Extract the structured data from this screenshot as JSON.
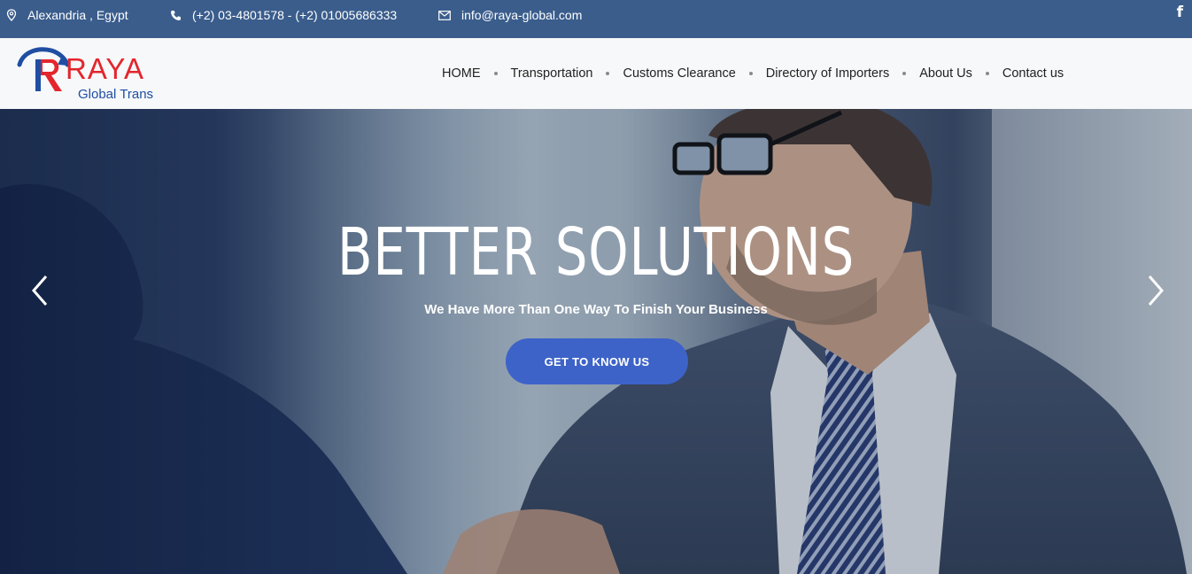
{
  "topbar": {
    "location": "Alexandria , Egypt",
    "phone": "(+2) 03-4801578 - (+2) 01005686333",
    "email": "info@raya-global.com",
    "social_icon": "facebook-icon",
    "social_label": "f"
  },
  "logo": {
    "name": "RAYA",
    "tagline": "Global Trans",
    "colors": {
      "red": "#e3262e",
      "blue": "#1f4ea3"
    }
  },
  "nav": {
    "items": [
      {
        "label": "HOME"
      },
      {
        "label": "Transportation"
      },
      {
        "label": "Customs Clearance"
      },
      {
        "label": "Directory of Importers"
      },
      {
        "label": "About Us"
      },
      {
        "label": "Contact us"
      }
    ]
  },
  "hero": {
    "title": "BETTER SOLUTIONS",
    "subtitle": "We Have More Than One Way To Finish Your Business",
    "cta_label": "GET TO KNOW US",
    "prev_icon": "chevron-left-icon",
    "next_icon": "chevron-right-icon"
  },
  "colors": {
    "topbar_bg": "#3a5d8c",
    "cta_bg": "#3d63c8"
  }
}
